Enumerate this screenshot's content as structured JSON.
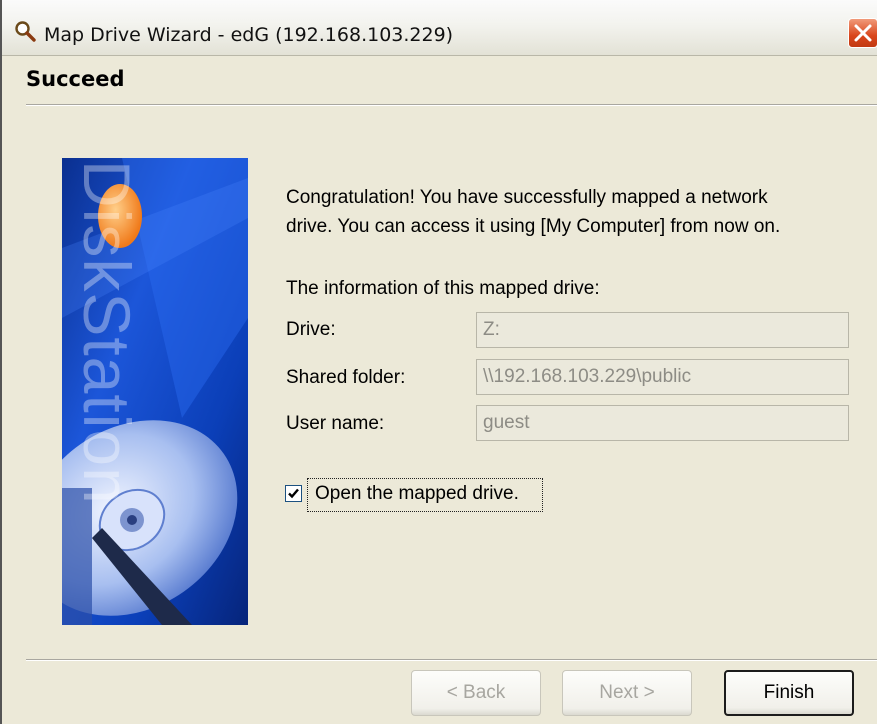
{
  "window": {
    "title": "Map Drive Wizard - edG (192.168.103.229)",
    "title_icon": "magnifier-icon",
    "close_icon": "close-icon"
  },
  "header": {
    "title": "Succeed"
  },
  "banner": {
    "brand_text": "DiskStation",
    "image": "hard-drive-illustration"
  },
  "main": {
    "message_line1": "Congratulation! You have successfully mapped a network",
    "message_line2": "drive. You can access it using [My Computer] from now on.",
    "info_heading": "The information of this mapped drive:",
    "fields": [
      {
        "label": "Drive:",
        "value": "Z:"
      },
      {
        "label": "Shared folder:",
        "value": "\\\\192.168.103.229\\public"
      },
      {
        "label": "User name:",
        "value": "guest"
      }
    ],
    "open_drive_checkbox": {
      "label": "Open the mapped drive.",
      "checked": true
    }
  },
  "footer": {
    "back_label": "< Back",
    "next_label": "Next >",
    "finish_label": "Finish"
  },
  "colors": {
    "dialog_bg": "#ece9d8",
    "banner_blue": "#0b3fb8",
    "close_red": "#d9461c"
  }
}
